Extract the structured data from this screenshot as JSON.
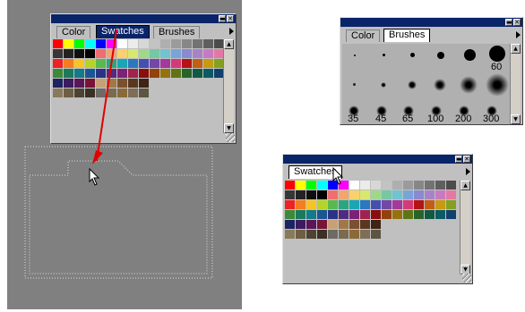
{
  "left_panel": {
    "tabs": [
      "Color",
      "Swatches",
      "Brushes"
    ],
    "window_buttons": {
      "minimize": "▬",
      "close": "✕"
    },
    "scroll_up": "▲",
    "scroll_down": "▼"
  },
  "brushes_panel": {
    "tabs": [
      "Color",
      "Brushes"
    ],
    "window_buttons": {
      "minimize": "▬",
      "close": "✕"
    },
    "labels": [
      "60",
      "35",
      "45",
      "65",
      "100",
      "200",
      "300"
    ]
  },
  "swatches_panel": {
    "tabs": [
      "Swatches"
    ],
    "window_buttons": {
      "minimize": "▬",
      "close": "✕"
    }
  },
  "colors": {
    "titlebar": "#0a246a",
    "arrow": "#e00000",
    "workspace": "#808080"
  },
  "swatches": [
    [
      "#ff0000",
      "#ffff00",
      "#00ff00",
      "#00ffff",
      "#0000ff",
      "#ff00ff",
      "#ffffff",
      "#ebebeb",
      "#d7d7d7",
      "#c3c3c3",
      "#afafaf",
      "#9b9b9b",
      "#878787",
      "#737373",
      "#5f5f5f",
      "#4b4b4b"
    ],
    [
      "#373737",
      "#232323",
      "#0f0f0f",
      "#000000",
      "#f06e6e",
      "#f4a46e",
      "#f8d26e",
      "#d8e86e",
      "#a0d88a",
      "#76c8a4",
      "#70c4d0",
      "#7aa4d8",
      "#8a8ad0",
      "#a882c8",
      "#c87ac0",
      "#e478a4"
    ],
    [
      "#ee2222",
      "#f47d22",
      "#f8c422",
      "#b4d42a",
      "#5ab84e",
      "#2aa67e",
      "#1aa6b4",
      "#2a78c0",
      "#4450b0",
      "#7446a8",
      "#a4389c",
      "#d43a78",
      "#b41414",
      "#c45e12",
      "#c89a12",
      "#84a01e"
    ],
    [
      "#3a8a3a",
      "#1a7a5a",
      "#127a88",
      "#1a5692",
      "#2a3484",
      "#522a80",
      "#7a2278",
      "#a0224e",
      "#8a0e0e",
      "#92420c",
      "#96720c",
      "#607416",
      "#286428",
      "#105a42",
      "#0c5a64",
      "#12406c"
    ],
    [
      "#1c2462",
      "#3c1c5e",
      "#5a1658",
      "#781438",
      "#c8a078",
      "#a07848",
      "#7a5030",
      "#5a3820",
      "#3e2414"
    ]
  ],
  "swatches_bottom_row": [
    "#8a7a5c",
    "#6e5e44",
    "#4e4232",
    "#3a3024",
    "#6e6a66",
    "#7a6a50",
    "#8a6a38",
    "#7e6e58",
    "#5e5444"
  ]
}
